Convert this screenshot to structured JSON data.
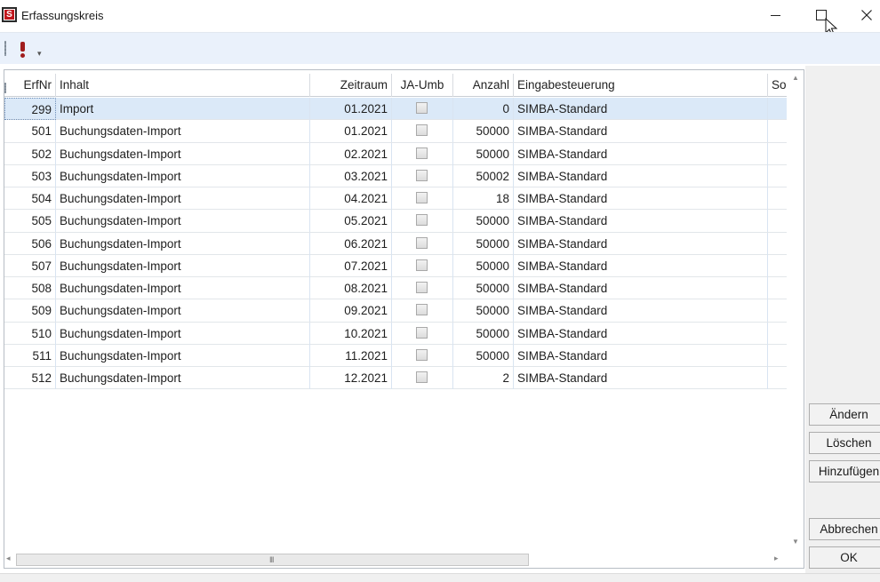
{
  "window": {
    "title": "Erfassungskreis",
    "icon_letter": "S",
    "controls": [
      "minimize",
      "maximize",
      "close"
    ]
  },
  "toolbar": {
    "items": [
      {
        "icon": "exclamation-icon",
        "color": "#a01d1d"
      },
      {
        "icon": "overflow-chevron-icon"
      }
    ]
  },
  "grid": {
    "columns": [
      "ErfNr",
      "Inhalt",
      "Zeitraum",
      "JA-Umb",
      "Anzahl",
      "Eingabesteuerung",
      "So"
    ],
    "rows": [
      {
        "erfnr": "299",
        "inhalt": "Import",
        "zeitraum": "01.2021",
        "ja_umb": false,
        "anzahl": "0",
        "eingabe": "SIMBA-Standard",
        "selected": true
      },
      {
        "erfnr": "501",
        "inhalt": "Buchungsdaten-Import",
        "zeitraum": "01.2021",
        "ja_umb": false,
        "anzahl": "50000",
        "eingabe": "SIMBA-Standard"
      },
      {
        "erfnr": "502",
        "inhalt": "Buchungsdaten-Import",
        "zeitraum": "02.2021",
        "ja_umb": false,
        "anzahl": "50000",
        "eingabe": "SIMBA-Standard"
      },
      {
        "erfnr": "503",
        "inhalt": "Buchungsdaten-Import",
        "zeitraum": "03.2021",
        "ja_umb": false,
        "anzahl": "50002",
        "eingabe": "SIMBA-Standard"
      },
      {
        "erfnr": "504",
        "inhalt": "Buchungsdaten-Import",
        "zeitraum": "04.2021",
        "ja_umb": false,
        "anzahl": "18",
        "eingabe": "SIMBA-Standard"
      },
      {
        "erfnr": "505",
        "inhalt": "Buchungsdaten-Import",
        "zeitraum": "05.2021",
        "ja_umb": false,
        "anzahl": "50000",
        "eingabe": "SIMBA-Standard"
      },
      {
        "erfnr": "506",
        "inhalt": "Buchungsdaten-Import",
        "zeitraum": "06.2021",
        "ja_umb": false,
        "anzahl": "50000",
        "eingabe": "SIMBA-Standard"
      },
      {
        "erfnr": "507",
        "inhalt": "Buchungsdaten-Import",
        "zeitraum": "07.2021",
        "ja_umb": false,
        "anzahl": "50000",
        "eingabe": "SIMBA-Standard"
      },
      {
        "erfnr": "508",
        "inhalt": "Buchungsdaten-Import",
        "zeitraum": "08.2021",
        "ja_umb": false,
        "anzahl": "50000",
        "eingabe": "SIMBA-Standard"
      },
      {
        "erfnr": "509",
        "inhalt": "Buchungsdaten-Import",
        "zeitraum": "09.2021",
        "ja_umb": false,
        "anzahl": "50000",
        "eingabe": "SIMBA-Standard"
      },
      {
        "erfnr": "510",
        "inhalt": "Buchungsdaten-Import",
        "zeitraum": "10.2021",
        "ja_umb": false,
        "anzahl": "50000",
        "eingabe": "SIMBA-Standard"
      },
      {
        "erfnr": "511",
        "inhalt": "Buchungsdaten-Import",
        "zeitraum": "11.2021",
        "ja_umb": false,
        "anzahl": "50000",
        "eingabe": "SIMBA-Standard"
      },
      {
        "erfnr": "512",
        "inhalt": "Buchungsdaten-Import",
        "zeitraum": "12.2021",
        "ja_umb": false,
        "anzahl": "2",
        "eingabe": "SIMBA-Standard"
      }
    ]
  },
  "buttons": {
    "aendern": "Ändern",
    "loeschen": "Löschen",
    "hinzufuegen": "Hinzufügen",
    "abbrechen": "Abbrechen",
    "ok": "OK"
  },
  "colors": {
    "selected_row": "#dbe9f8",
    "toolbar_bg": "#eaf1fb",
    "brand_red": "#c0161c"
  }
}
